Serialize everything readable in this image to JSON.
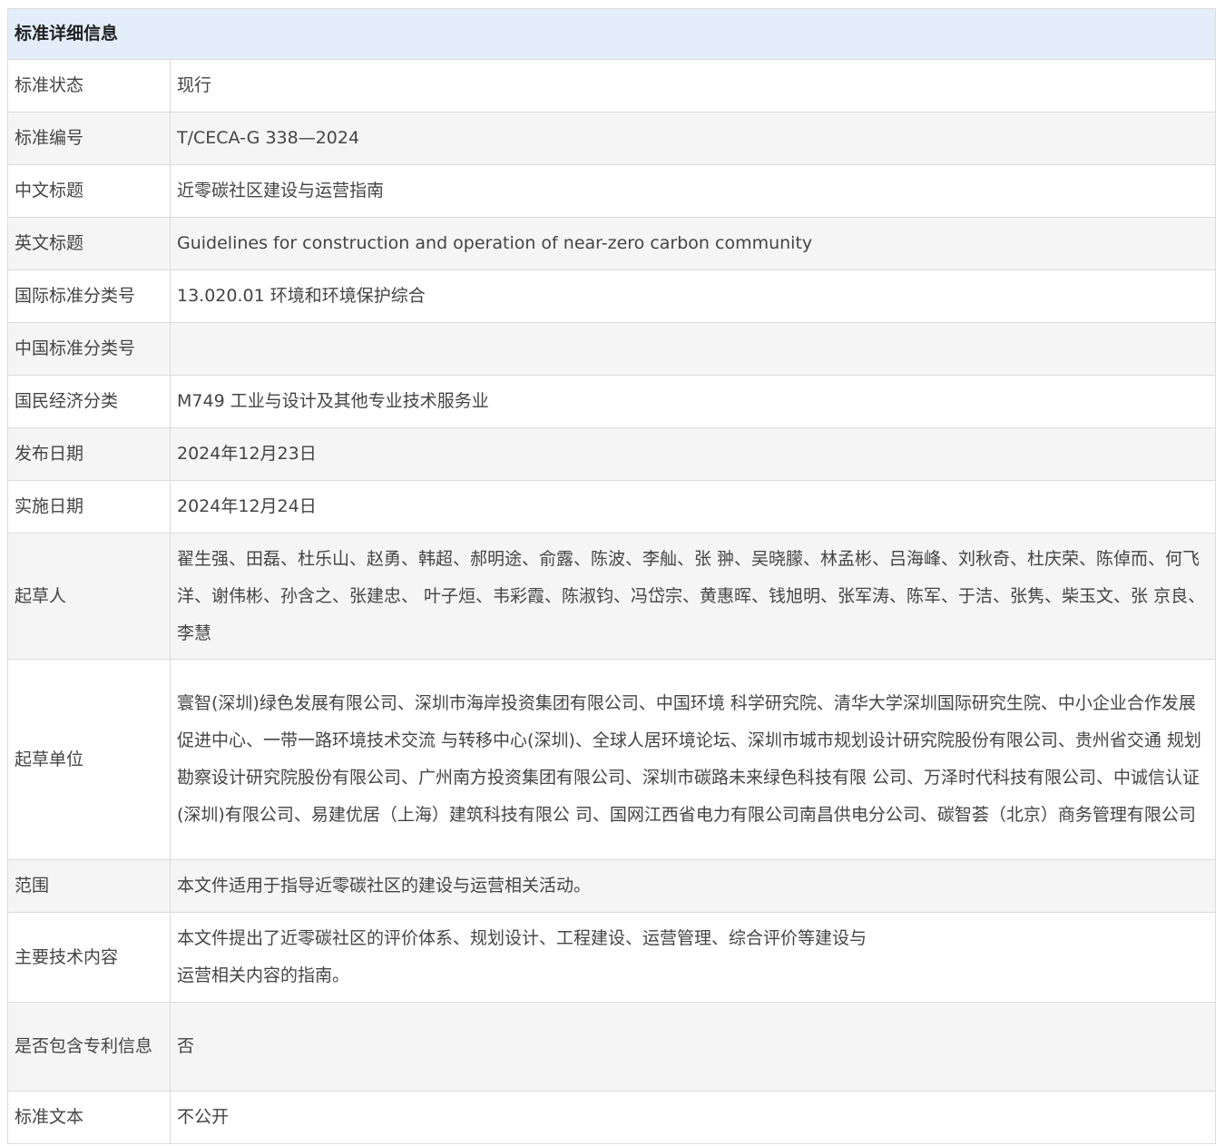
{
  "header": {
    "title": "标准详细信息"
  },
  "rows": [
    {
      "label": "标准状态",
      "value": "现行"
    },
    {
      "label": "标准编号",
      "value": "T/CECA-G 338—2024"
    },
    {
      "label": "中文标题",
      "value": "近零碳社区建设与运营指南"
    },
    {
      "label": "英文标题",
      "value": "Guidelines for construction and operation of near-zero carbon community"
    },
    {
      "label": "国际标准分类号",
      "value": "13.020.01 环境和环境保护综合"
    },
    {
      "label": "中国标准分类号",
      "value": ""
    },
    {
      "label": "国民经济分类",
      "value": "M749 工业与设计及其他专业技术服务业"
    },
    {
      "label": "发布日期",
      "value": "2024年12月23日"
    },
    {
      "label": "实施日期",
      "value": "2024年12月24日"
    },
    {
      "label": "起草人",
      "value": "翟生强、田磊、杜乐山、赵勇、韩超、郝明途、俞露、陈波、李舢、张 翀、吴晓朦、林孟彬、吕海峰、刘秋奇、杜庆荣、陈倬而、何飞洋、谢伟彬、孙含之、张建忠、 叶子烜、韦彩霞、陈淑钧、冯岱宗、黄惠晖、钱旭明、张军涛、陈军、于洁、张隽、柴玉文、张 京良、李慧"
    },
    {
      "label": "起草单位",
      "value": "寰智(深圳)绿色发展有限公司、深圳市海岸投资集团有限公司、中国环境 科学研究院、清华大学深圳国际研究生院、中小企业合作发展促进中心、一带一路环境技术交流 与转移中心(深圳)、全球人居环境论坛、深圳市城市规划设计研究院股份有限公司、贵州省交通 规划勘察设计研究院股份有限公司、广州南方投资集团有限公司、深圳市碳路未来绿色科技有限 公司、万泽时代科技有限公司、中诚信认证(深圳)有限公司、易建优居（上海）建筑科技有限公 司、国网江西省电力有限公司南昌供电分公司、碳智荟（北京）商务管理有限公司"
    },
    {
      "label": "范围",
      "value": "本文件适用于指导近零碳社区的建设与运营相关活动。"
    },
    {
      "label": "主要技术内容",
      "value_lines": [
        "本文件提出了近零碳社区的评价体系、规划设计、工程建设、运营管理、综合评价等建设与",
        "运营相关内容的指南。"
      ]
    },
    {
      "label": "是否包含专利信息",
      "value": "否"
    },
    {
      "label": "标准文本",
      "value": "不公开"
    }
  ]
}
